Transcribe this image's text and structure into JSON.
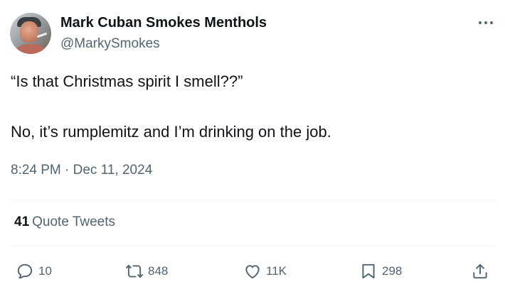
{
  "author": {
    "display_name": "Mark Cuban Smokes Menthols",
    "handle": "@MarkySmokes"
  },
  "tweet": {
    "line1": "“Is that Christmas spirit I smell??”",
    "line2": "No, it’s rumplemitz and I’m drinking on the job.",
    "timestamp": "8:24 PM · Dec 11, 2024"
  },
  "stats": {
    "quote_count": "41",
    "quote_label": "Quote Tweets"
  },
  "actions": {
    "replies": "10",
    "retweets": "848",
    "likes": "11K",
    "bookmarks": "298"
  },
  "icons": {
    "more": "more-options-icon",
    "reply": "reply-icon",
    "retweet": "retweet-icon",
    "like": "heart-icon",
    "bookmark": "bookmark-icon",
    "share": "share-icon"
  },
  "colors": {
    "text": "#0f1419",
    "secondary": "#536471",
    "divider": "#eff3f4"
  }
}
